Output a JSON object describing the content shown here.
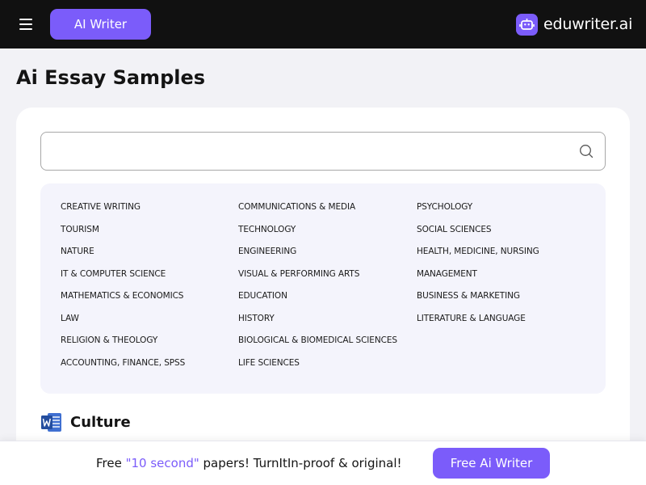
{
  "header": {
    "menu_icon": "hamburger-icon",
    "ai_writer_label": "AI Writer",
    "brand_name": "eduwriter.ai",
    "brand_icon": "robot-logo-icon",
    "accent_color": "#7b5cfa"
  },
  "page": {
    "title": "Ai Essay Samples"
  },
  "search": {
    "value": "",
    "placeholder": "",
    "icon": "search-icon"
  },
  "categories": {
    "col1": [
      "CREATIVE WRITING",
      "TOURISM",
      "NATURE",
      "IT & COMPUTER SCIENCE",
      "MATHEMATICS & ECONOMICS",
      "LAW",
      "RELIGION & THEOLOGY",
      "ACCOUNTING, FINANCE, SPSS"
    ],
    "col2": [
      "COMMUNICATIONS & MEDIA",
      "TECHNOLOGY",
      "ENGINEERING",
      "VISUAL & PERFORMING ARTS",
      "EDUCATION",
      "HISTORY",
      "BIOLOGICAL & BIOMEDICAL SCIENCES",
      "LIFE SCIENCES"
    ],
    "col3": [
      "PSYCHOLOGY",
      "SOCIAL SCIENCES",
      "HEALTH, MEDICINE, NURSING",
      "MANAGEMENT",
      "BUSINESS & MARKETING",
      "LITERATURE & LANGUAGE"
    ]
  },
  "section": {
    "icon": "word-document-icon",
    "title": "Culture"
  },
  "promo": {
    "before": "Free ",
    "highlight": "\"10 second\"",
    "after": " papers! TurnItIn-proof & original!",
    "button_label": "Free Ai Writer"
  }
}
